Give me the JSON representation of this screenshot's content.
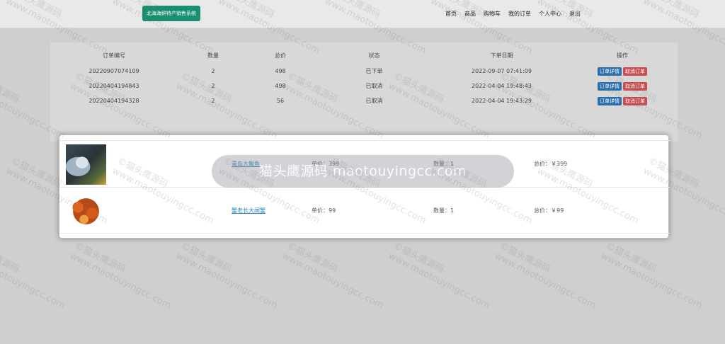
{
  "header": {
    "logo_text": "北海海鲜特产销售系统",
    "nav": [
      "首页",
      "商品",
      "购物车",
      "我的订单",
      "个人中心",
      "退出"
    ]
  },
  "orders": {
    "columns": [
      "订单编号",
      "数量",
      "总价",
      "状态",
      "下单日期",
      "操作"
    ],
    "rows": [
      {
        "id": "20220907074109",
        "qty": "2",
        "total": "498",
        "status": "已下单",
        "date": "2022-09-07 07:41:09"
      },
      {
        "id": "20220404194843",
        "qty": "2",
        "total": "498",
        "status": "已取消",
        "date": "2022-04-04 19:48:43"
      },
      {
        "id": "20220404194328",
        "qty": "2",
        "total": "56",
        "status": "已取消",
        "date": "2022-04-04 19:43:29"
      }
    ],
    "detail_label": "订单详情",
    "cancel_label": "取消订单"
  },
  "modal": {
    "items": [
      {
        "name": "青岛大鲅鱼",
        "price": "单价：399",
        "qty": "数量：1",
        "total": "总价：￥399",
        "image": "fish"
      },
      {
        "name": "蟹老长大闸蟹",
        "price": "单价：99",
        "qty": "数量：1",
        "total": "总价：￥99",
        "image": "crab"
      }
    ]
  },
  "watermark": {
    "pill_text": "猫头鹰源码 maotouyingcc.com",
    "tile_line1": "©猫头鹰源码",
    "tile_line2": "www.maotouyingcc.com"
  }
}
